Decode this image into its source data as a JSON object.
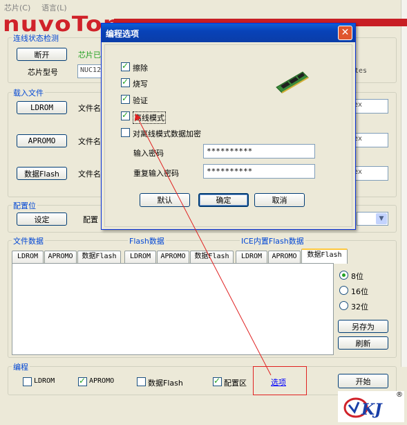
{
  "menu": {
    "chip": "芯片(C)",
    "language": "语言(L)"
  },
  "logo": "nuvoTon",
  "connection": {
    "title": "连线状态检测",
    "disconnect_btn": "断开",
    "chip_status": "芯片已",
    "chip_model_label": "芯片型号",
    "chip_model_value": "NUC12",
    "right_text": "tes"
  },
  "load_files": {
    "title": "载入文件",
    "ldrom_btn": "LDROM",
    "aprom_btn": "APROMO",
    "dataflash_btn": "数据Flash",
    "file_label": "文件名",
    "field_suffix": "ex"
  },
  "config": {
    "title": "配置位",
    "set_btn": "设定",
    "label": "配置"
  },
  "file_data": {
    "group_file": "文件数据",
    "group_flash": "Flash数据",
    "group_ice": "ICE内置Flash数据",
    "tabs": [
      "LDROM",
      "APROMO",
      "数据Flash",
      "LDROM",
      "APROMO",
      "数据Flash",
      "LDROM",
      "APROMO",
      "数据Flash"
    ],
    "radios": [
      "8位",
      "16位",
      "32位"
    ],
    "save_as": "另存为",
    "refresh": "刷新"
  },
  "program": {
    "title": "编程",
    "checks": [
      "LDROM",
      "APROMO",
      "数据Flash",
      "配置区"
    ],
    "options_link": "选项",
    "start_btn": "开始"
  },
  "dialog": {
    "title": "编程选项",
    "options": [
      "擦除",
      "烧写",
      "验证",
      "离线模式",
      "对离线模式数据加密"
    ],
    "password_label": "输入密码",
    "password_value": "**********",
    "repeat_label": "重复输入密码",
    "repeat_value": "**********",
    "default_btn": "默认",
    "ok_btn": "确定",
    "cancel_btn": "取消"
  },
  "watermark": {
    "text": "CKJ",
    "registered": "®"
  },
  "colors": {
    "accent": "#0046D5",
    "brand": "#D0222A",
    "highlight": "#E02020"
  }
}
